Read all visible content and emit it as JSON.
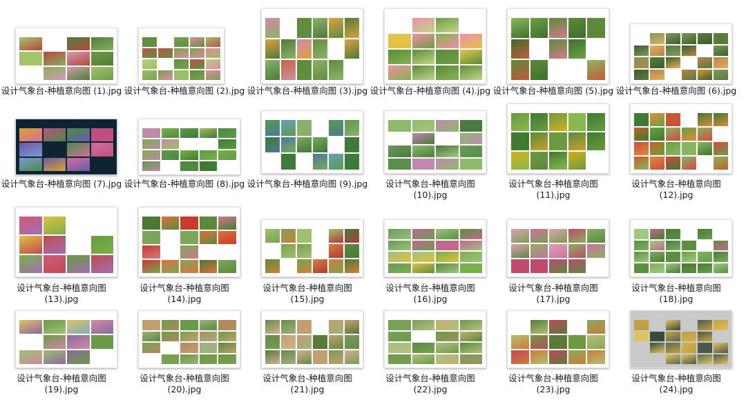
{
  "files": [
    {
      "name": "设计气象台-种植意向图 (1).jpg",
      "line1": "设计气象台-种植意向图 (1).jpg",
      "line2": ""
    },
    {
      "name": "设计气象台-种植意向图 (2).jpg",
      "line1": "设计气象台-种植意向图 (2).jpg",
      "line2": ""
    },
    {
      "name": "设计气象台-种植意向图 (3).jpg",
      "line1": "设计气象台-种植意向图 (3).jpg",
      "line2": ""
    },
    {
      "name": "设计气象台-种植意向图 (4).jpg",
      "line1": "设计气象台-种植意向图 (4).jpg",
      "line2": ""
    },
    {
      "name": "设计气象台-种植意向图 (5).jpg",
      "line1": "设计气象台-种植意向图 (5).jpg",
      "line2": ""
    },
    {
      "name": "设计气象台-种植意向图 (6).jpg",
      "line1": "设计气象台-种植意向图 (6).jpg",
      "line2": ""
    },
    {
      "name": "设计气象台-种植意向图 (7).jpg",
      "line1": "设计气象台-种植意向图 (7).jpg",
      "line2": ""
    },
    {
      "name": "设计气象台-种植意向图 (8).jpg",
      "line1": "设计气象台-种植意向图 (8).jpg",
      "line2": ""
    },
    {
      "name": "设计气象台-种植意向图 (9).jpg",
      "line1": "设计气象台-种植意向图 (9).jpg",
      "line2": ""
    },
    {
      "name": "设计气象台-种植意向图 (10).jpg",
      "line1": "设计气象台-种植意向图",
      "line2": "(10).jpg"
    },
    {
      "name": "设计气象台-种植意向图 (11).jpg",
      "line1": "设计气象台-种植意向图",
      "line2": "(11).jpg"
    },
    {
      "name": "设计气象台-种植意向图 (12).jpg",
      "line1": "设计气象台-种植意向图",
      "line2": "(12).jpg"
    },
    {
      "name": "设计气象台-种植意向图 (13).jpg",
      "line1": "设计气象台-种植意向图",
      "line2": "(13).jpg"
    },
    {
      "name": "设计气象台-种植意向图 (14).jpg",
      "line1": "设计气象台-种植意向图",
      "line2": "(14).jpg"
    },
    {
      "name": "设计气象台-种植意向图 (15).jpg",
      "line1": "设计气象台-种植意向图",
      "line2": "(15).jpg"
    },
    {
      "name": "设计气象台-种植意向图 (16).jpg",
      "line1": "设计气象台-种植意向图",
      "line2": "(16).jpg"
    },
    {
      "name": "设计气象台-种植意向图 (17).jpg",
      "line1": "设计气象台-种植意向图",
      "line2": "(17).jpg"
    },
    {
      "name": "设计气象台-种植意向图 (18).jpg",
      "line1": "设计气象台-种植意向图",
      "line2": "(18).jpg"
    },
    {
      "name": "设计气象台-种植意向图 (19).jpg",
      "line1": "设计气象台-种植意向图",
      "line2": "(19).jpg"
    },
    {
      "name": "设计气象台-种植意向图 (20).jpg",
      "line1": "设计气象台-种植意向图",
      "line2": "(20).jpg"
    },
    {
      "name": "设计气象台-种植意向图 (21).jpg",
      "line1": "设计气象台-种植意向图",
      "line2": "(21).jpg"
    },
    {
      "name": "设计气象台-种植意向图 (22).jpg",
      "line1": "设计气象台-种植意向图",
      "line2": "(22).jpg"
    },
    {
      "name": "设计气象台-种植意向图 (23).jpg",
      "line1": "设计气象台-种植意向图",
      "line2": "(23).jpg"
    },
    {
      "name": "设计气象台-种植意向图 (24).jpg",
      "line1": "设计气象台-种植意向图",
      "line2": "(24).jpg"
    }
  ],
  "thumbnail_palettes": [
    [
      "#6f9a48",
      "#b9463f",
      "#8caf5e",
      "#d59ab0",
      "#4c7f3a",
      "#a4c46a"
    ],
    [
      "#7aa04f",
      "#c0504d",
      "#9cbf63",
      "#e08aa0",
      "#5f8f3f",
      "#b8d07a"
    ],
    [
      "#4e7a37",
      "#8bb26a",
      "#5f8d3c",
      "#c26a3a",
      "#d38aa8",
      "#e0a040"
    ],
    [
      "#5a8d3b",
      "#84b24f",
      "#e4c24a",
      "#f08fa8",
      "#6c9e45",
      "#c3d48a"
    ],
    [
      "#3f6e2d",
      "#6ea04a",
      "#c05a3a",
      "#8fb85e",
      "#d47a8f",
      "#5c8a3a"
    ],
    [
      "#3c5e2e",
      "#d49a2a",
      "#7c9a5a",
      "#b8844a",
      "#5a7a3e",
      "#e0b060"
    ],
    [
      "#6a5aa8",
      "#c05080",
      "#e0a030",
      "#7a9ad0",
      "#4a8a4a",
      "#d070a0"
    ],
    [
      "#4f8a3c",
      "#7ab04a",
      "#c08aa8",
      "#5e9a4a",
      "#a0c060",
      "#3e7a32"
    ],
    [
      "#3e7a3a",
      "#6aa0c0",
      "#5a9a4a",
      "#8ab070",
      "#4a7a9a",
      "#7aa85a"
    ],
    [
      "#5a8e4a",
      "#8cbc6a",
      "#c088b0",
      "#6a9a58",
      "#a8c480",
      "#4a7a40"
    ],
    [
      "#d4b21a",
      "#6a9a40",
      "#3e7a30",
      "#8ab84e",
      "#c8a030",
      "#5a8a3a"
    ],
    [
      "#3e7a30",
      "#c0602a",
      "#e08a3a",
      "#6aa040",
      "#d04a40",
      "#8ab460"
    ],
    [
      "#d05a7a",
      "#6a9a40",
      "#e0c040",
      "#a070b0",
      "#c04a50",
      "#7ab04a"
    ],
    [
      "#c83a2a",
      "#5a8a3a",
      "#e0703a",
      "#7aa85a",
      "#d07a8a",
      "#4a7a32"
    ],
    [
      "#5a8a3a",
      "#b03a3a",
      "#7aa050",
      "#d08040",
      "#4a7a3a",
      "#a0c070"
    ],
    [
      "#7ab04a",
      "#e0c040",
      "#c06a8a",
      "#5a9040",
      "#a0c080",
      "#6a9a5a"
    ],
    [
      "#c04a6a",
      "#7aa050",
      "#d070a0",
      "#5a8a40",
      "#e0a0b0",
      "#8ab060"
    ],
    [
      "#5a9040",
      "#7ab060",
      "#c06a8a",
      "#4a7a3a",
      "#a0c880",
      "#6aa04a"
    ],
    [
      "#8a6aa0",
      "#d08aa0",
      "#6a9a4a",
      "#e0c060",
      "#7ab0c0",
      "#a0c070"
    ],
    [
      "#7aa050",
      "#b08a60",
      "#6a9a4a",
      "#c0a070",
      "#5a8a3a",
      "#a0b080"
    ],
    [
      "#7a9a5a",
      "#c0a070",
      "#6a8a4a",
      "#a0b080",
      "#5a7a3a",
      "#d0b090"
    ],
    [
      "#6a9a4a",
      "#c0b070",
      "#7aa058",
      "#a09060",
      "#5a8a3a",
      "#b0c080"
    ],
    [
      "#b0c070",
      "#c04a5a",
      "#6a9a40",
      "#d07a3a",
      "#8aaa60",
      "#5a7a3a"
    ],
    [
      "#4a5a4a",
      "#c0a040",
      "#3a4a3a",
      "#e0c060",
      "#5a6a52",
      "#d0b050"
    ]
  ]
}
